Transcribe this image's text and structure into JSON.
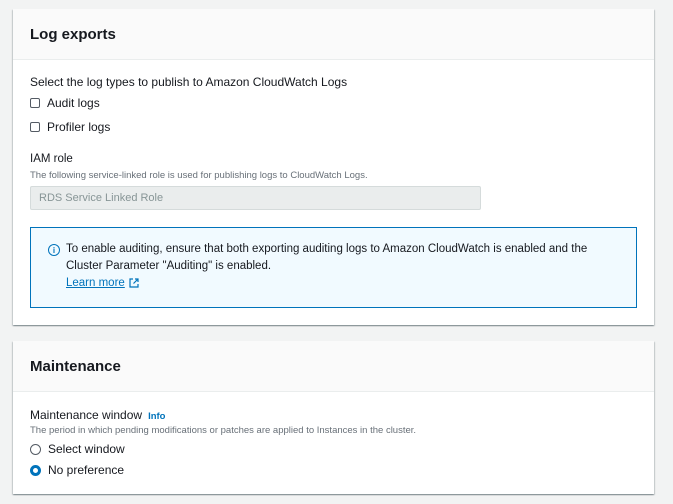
{
  "log_exports": {
    "title": "Log exports",
    "select_label": "Select the log types to publish to Amazon CloudWatch Logs",
    "checkboxes": [
      {
        "label": "Audit logs",
        "checked": false
      },
      {
        "label": "Profiler logs",
        "checked": false
      }
    ],
    "iam_role": {
      "label": "IAM role",
      "description": "The following service-linked role is used for publishing logs to CloudWatch Logs.",
      "value": "RDS Service Linked Role"
    },
    "alert": {
      "icon": "info-icon",
      "text": "To enable auditing, ensure that both exporting auditing logs to Amazon CloudWatch is enabled and the Cluster Parameter \"Auditing\" is enabled.",
      "link": "Learn more"
    }
  },
  "maintenance": {
    "title": "Maintenance",
    "window_label": "Maintenance window",
    "info": "Info",
    "description": "The period in which pending modifications or patches are applied to Instances in the cluster.",
    "options": [
      {
        "label": "Select window",
        "selected": false
      },
      {
        "label": "No preference",
        "selected": true
      }
    ]
  },
  "colors": {
    "accent": "#0073bb",
    "alert_bg": "#f1faff"
  }
}
